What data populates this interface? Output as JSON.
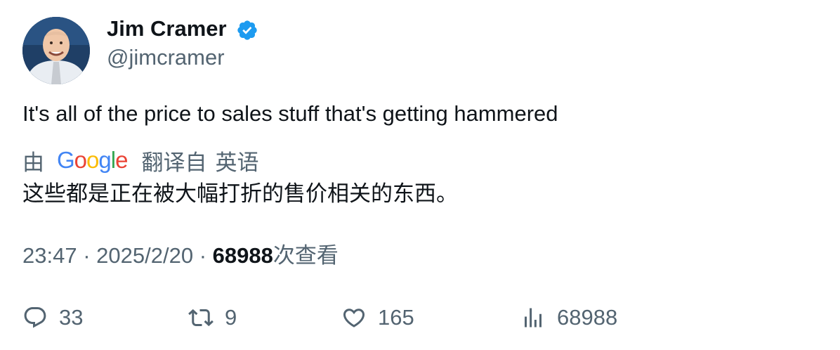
{
  "author": {
    "name": "Jim Cramer",
    "handle": "@jimcramer",
    "verified_icon": "verified-badge-icon",
    "verified_color": "#1d9bf0"
  },
  "tweet": {
    "text": "It's all of the price to sales stuff that's getting hammered"
  },
  "translation": {
    "by_label": "由",
    "provider_logo": "Google",
    "from_label": "翻译自",
    "language": "英语",
    "text": "这些都是正在被大幅打折的售价相关的东西。"
  },
  "meta": {
    "time": "23:47",
    "separator": "·",
    "date": "2025/2/20",
    "views_count": "68988",
    "views_suffix": "次查看"
  },
  "actions": {
    "reply": {
      "icon": "reply-icon",
      "count": "33"
    },
    "retweet": {
      "icon": "retweet-icon",
      "count": "9"
    },
    "like": {
      "icon": "heart-icon",
      "count": "165"
    },
    "views": {
      "icon": "analytics-icon",
      "count": "68988"
    }
  },
  "colors": {
    "text": "#0f1419",
    "secondary": "#536471",
    "accent": "#1d9bf0"
  }
}
